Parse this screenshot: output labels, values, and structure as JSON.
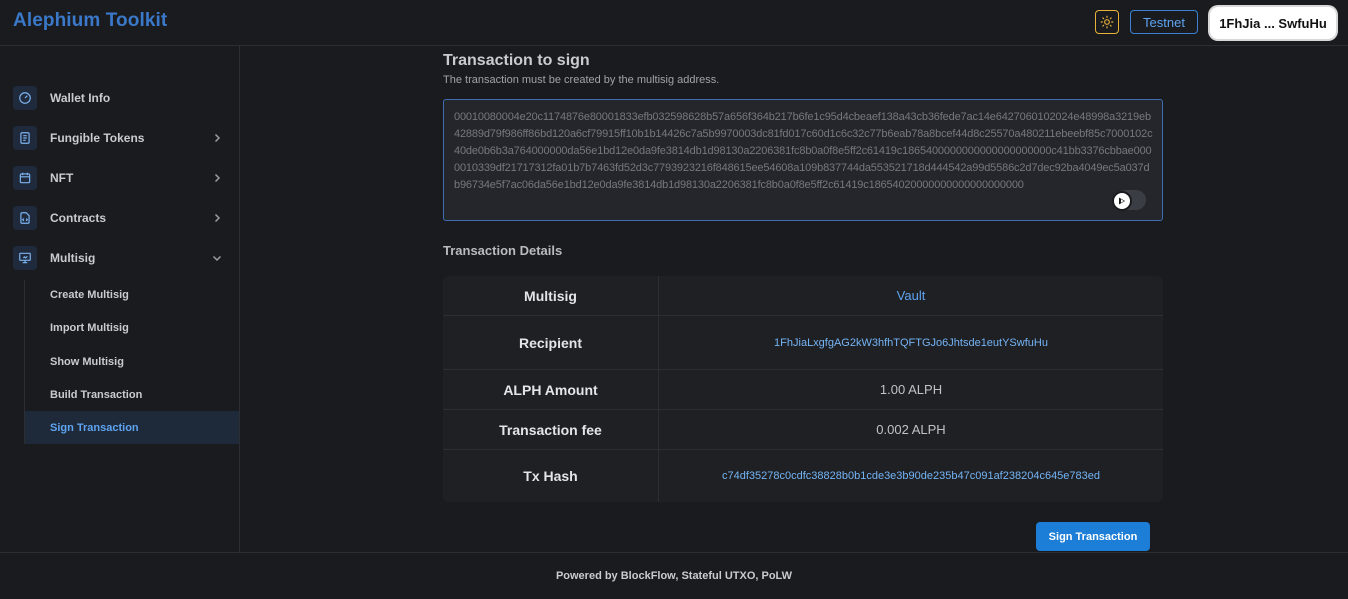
{
  "header": {
    "brand": "Alephium Toolkit",
    "theme_icon": "sun-icon",
    "network": "Testnet",
    "wallet": "1FhJia ... SwfuHu"
  },
  "sidebar": {
    "items": [
      {
        "label": "Wallet Info",
        "icon": "gauge-icon"
      },
      {
        "label": "Fungible Tokens",
        "icon": "document-icon"
      },
      {
        "label": "NFT",
        "icon": "calendar-icon"
      },
      {
        "label": "Contracts",
        "icon": "file-code-icon"
      },
      {
        "label": "Multisig",
        "icon": "presentation-icon"
      }
    ],
    "multisig_sub": [
      {
        "label": "Create Multisig"
      },
      {
        "label": "Import Multisig"
      },
      {
        "label": "Show Multisig"
      },
      {
        "label": "Build Transaction"
      },
      {
        "label": "Sign Transaction"
      }
    ]
  },
  "main": {
    "title": "Transaction to sign",
    "subtitle": "The transaction must be created by the multisig address.",
    "tx_value": "00010080004e20c1174876e80001833efb032598628b57a656f364b217b6fe1c95d4cbeaef138a43cb36fede7ac14e6427060102024e48998a3219eb42889d79f986ff86bd120a6cf79915ff10b1b14426c7a5b9970003dc81fd017c60d1c6c32c77b6eab78a8bcef44d8c25570a480211ebeebf85c7000102c40de0b6b3a764000000da56e1bd12e0da9fe3814db1d98130a2206381fc8b0a0f8e5ff2c61419c1865400000000000000000000c41bb3376cbbae0000010339df21717312fa01b7b7463fd52d3c7793923216f848615ee54608a109b837744da553521718d444542a99d5586c2d7dec92ba4049ec5a037db96734e5f7ac06da56e1bd12e0da9fe3814db1d98130a2206381fc8b0a0f8e5ff2c61419c18654020000000000000000000",
    "details_title": "Transaction Details",
    "details": {
      "multisig_key": "Multisig",
      "multisig_val": "Vault",
      "recipient_key": "Recipient",
      "recipient_val": "1FhJiaLxgfgAG2kW3hfhTQFTGJo6Jhtsde1eutYSwfuHu",
      "amount_key": "ALPH Amount",
      "amount_val": "1.00 ALPH",
      "fee_key": "Transaction fee",
      "fee_val": "0.002 ALPH",
      "hash_key": "Tx Hash",
      "hash_val": "c74df35278c0cdfc38828b0b1cde3e3b90de235b47c091af238204c645e783ed"
    },
    "sign_button": "Sign Transaction"
  },
  "footer": {
    "text": "Powered by BlockFlow, Stateful UTXO, PoLW"
  },
  "colors": {
    "accent": "#1c7ed6",
    "brand": "#3a78c9",
    "link": "#5ea3f0",
    "theme_border": "#e8b13a"
  }
}
